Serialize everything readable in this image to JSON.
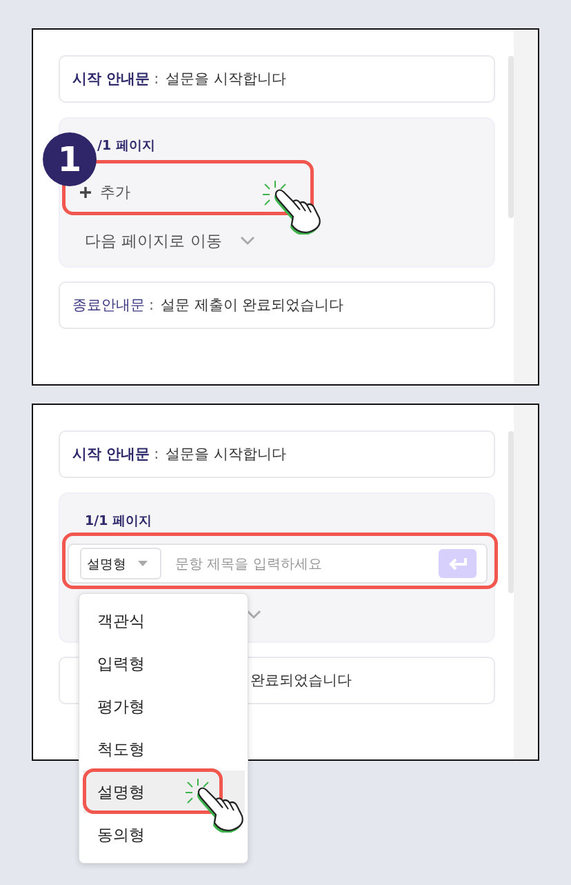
{
  "panel_1": {
    "step_badge": "1",
    "start_notice": {
      "label": "시작 안내문",
      "separator": ":",
      "value": "설문을 시작합니다"
    },
    "page": {
      "title": "/1 페이지",
      "add_button": "추가",
      "next_page_select": "다음 페이지로 이동"
    },
    "end_notice": {
      "label": "종료안내문",
      "separator": ":",
      "value": "설문 제출이 완료되었습니다"
    }
  },
  "panel_2": {
    "start_notice": {
      "label": "시작 안내문",
      "separator": ":",
      "value": "설문을 시작합니다"
    },
    "page": {
      "title": "1/1 페이지",
      "question_row": {
        "type_select": "설명형",
        "placeholder": "문항 제목을 입력하세요"
      }
    },
    "end_notice_visible": "완료되었습니다",
    "type_menu": [
      {
        "label": "객관식",
        "selected": false
      },
      {
        "label": "입력형",
        "selected": false
      },
      {
        "label": "평가형",
        "selected": false
      },
      {
        "label": "척도형",
        "selected": false
      },
      {
        "label": "설명형",
        "selected": true
      },
      {
        "label": "동의형",
        "selected": false
      }
    ]
  }
}
